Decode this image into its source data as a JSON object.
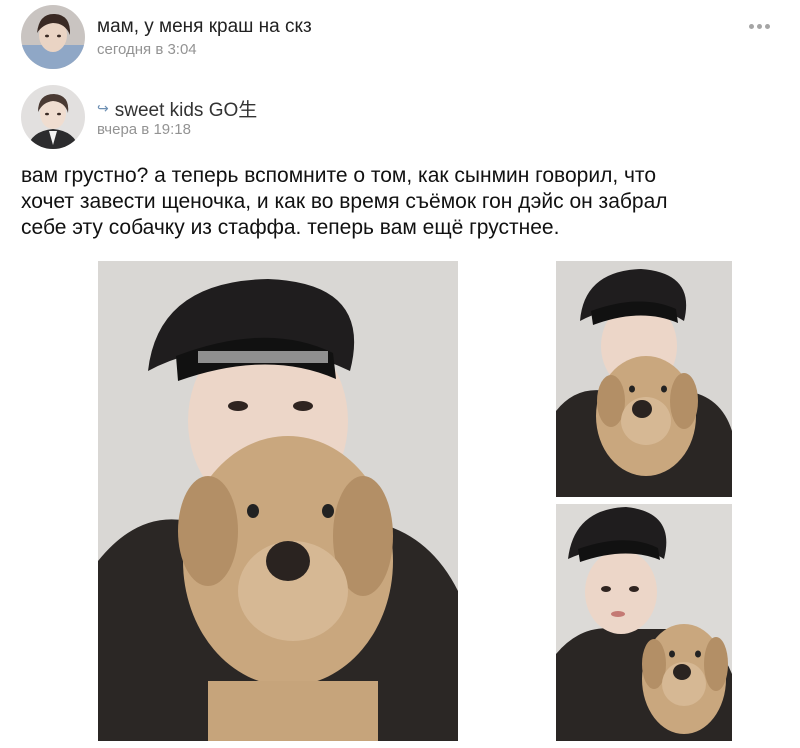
{
  "post": {
    "title": "мам, у меня краш на скз",
    "time": "сегодня в 3:04",
    "more_icon": "more-dots-icon"
  },
  "repost": {
    "source_name": "sweet kids GO生",
    "time": "вчера в 19:18",
    "icon": "repost-arrow-icon",
    "icon_glyph": "↪"
  },
  "content": {
    "text": "вам грустно? а теперь вспомните о том, как сынмин говорил, что\nхочет завести щеночка, и как во время съёмок гон дэйс он забрал\nсебе эту собачку из стаффа. теперь вам ещё грустнее."
  },
  "colors": {
    "meta_text": "#939393",
    "repost_icon": "#6d8fb3",
    "photo_bg": "#d8d6d3"
  }
}
